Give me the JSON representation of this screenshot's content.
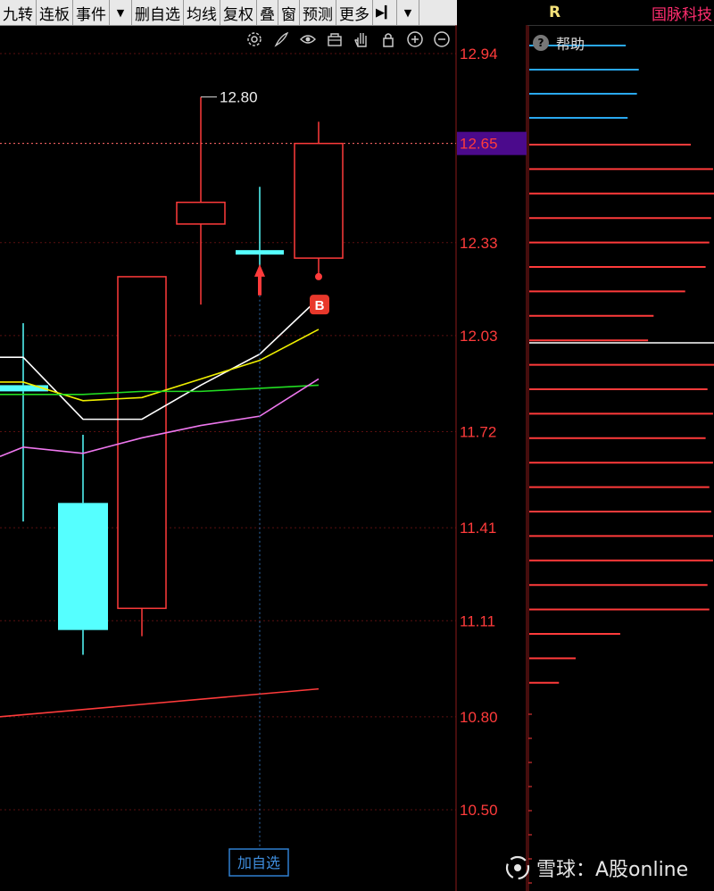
{
  "toolbar": {
    "items": [
      {
        "label": "九转"
      },
      {
        "label": "连板"
      },
      {
        "label": "事件"
      },
      {
        "label": "▼"
      },
      {
        "label": "删自选"
      },
      {
        "label": "均线"
      },
      {
        "label": "复权"
      },
      {
        "label": "叠"
      },
      {
        "label": "窗"
      },
      {
        "label": "预测"
      },
      {
        "label": "更多"
      },
      {
        "label": "▶▎"
      },
      {
        "label": "▼"
      }
    ]
  },
  "chart_tools": [
    "gear-icon",
    "brush-icon",
    "eye-icon",
    "basket-icon",
    "hand-icon",
    "lock-icon",
    "zoom-in-icon",
    "zoom-out-icon"
  ],
  "right_panel": {
    "marker": "R",
    "stock_name": "国脉科技",
    "help_label": "帮助"
  },
  "chart": {
    "current_price": "12.65",
    "high_annotation": "12.80",
    "buy_marker": "B",
    "add_watchlist_label": "加自选",
    "colors": {
      "up": "#ff3b3b",
      "down": "#55ffff",
      "ma_white": "#ffffff",
      "ma_yellow": "#f0f000",
      "ma_green": "#22dd22",
      "ma_violet": "#ee77ee",
      "axis_text": "#ff3b3b",
      "current_bg": "#4b0a8c"
    }
  },
  "chart_data": {
    "type": "candlestick",
    "y_axis_ticks": [
      12.94,
      12.65,
      12.33,
      12.03,
      11.72,
      11.41,
      11.11,
      10.8,
      10.5
    ],
    "ylim": [
      10.4,
      13.05
    ],
    "candles": [
      {
        "open": 11.87,
        "close": 11.85,
        "high": 12.07,
        "low": 11.43,
        "dir": "down"
      },
      {
        "open": 11.49,
        "close": 11.08,
        "high": 11.71,
        "low": 11.0,
        "dir": "down"
      },
      {
        "open": 11.15,
        "close": 12.22,
        "high": 12.22,
        "low": 11.06,
        "dir": "up"
      },
      {
        "open": 12.46,
        "close": 12.39,
        "high": 12.8,
        "low": 12.13,
        "dir": "up"
      },
      {
        "open": 12.3,
        "close": 12.3,
        "high": 12.51,
        "low": 12.2,
        "dir": "down"
      },
      {
        "open": 12.65,
        "close": 12.28,
        "high": 12.72,
        "low": 12.22,
        "dir": "up"
      }
    ],
    "ma_series": [
      {
        "color": "white",
        "values": [
          11.96,
          11.76,
          11.76,
          11.87,
          11.97,
          12.15
        ]
      },
      {
        "color": "yellow",
        "values": [
          11.88,
          11.82,
          11.83,
          11.89,
          11.95,
          12.05
        ]
      },
      {
        "color": "green",
        "values": [
          11.84,
          11.84,
          11.85,
          11.85,
          11.86,
          11.87
        ]
      },
      {
        "color": "violet",
        "values": [
          11.67,
          11.65,
          11.7,
          11.74,
          11.77,
          11.89
        ]
      }
    ],
    "long_line": {
      "start": 10.8,
      "end": 10.89
    }
  },
  "distribution": {
    "blue_bars": [
      0.52,
      0.59,
      0.58,
      0.53
    ],
    "red_bars": [
      0.87,
      0.99,
      1.0,
      0.98,
      0.97,
      0.95,
      0.84,
      0.67,
      0.64,
      1.0,
      0.96,
      0.99,
      0.95,
      0.99,
      0.97,
      0.98,
      0.99,
      0.99,
      0.96,
      0.97,
      0.49,
      0.25,
      0.16
    ]
  },
  "watermark": {
    "text": "雪球：A股online"
  }
}
